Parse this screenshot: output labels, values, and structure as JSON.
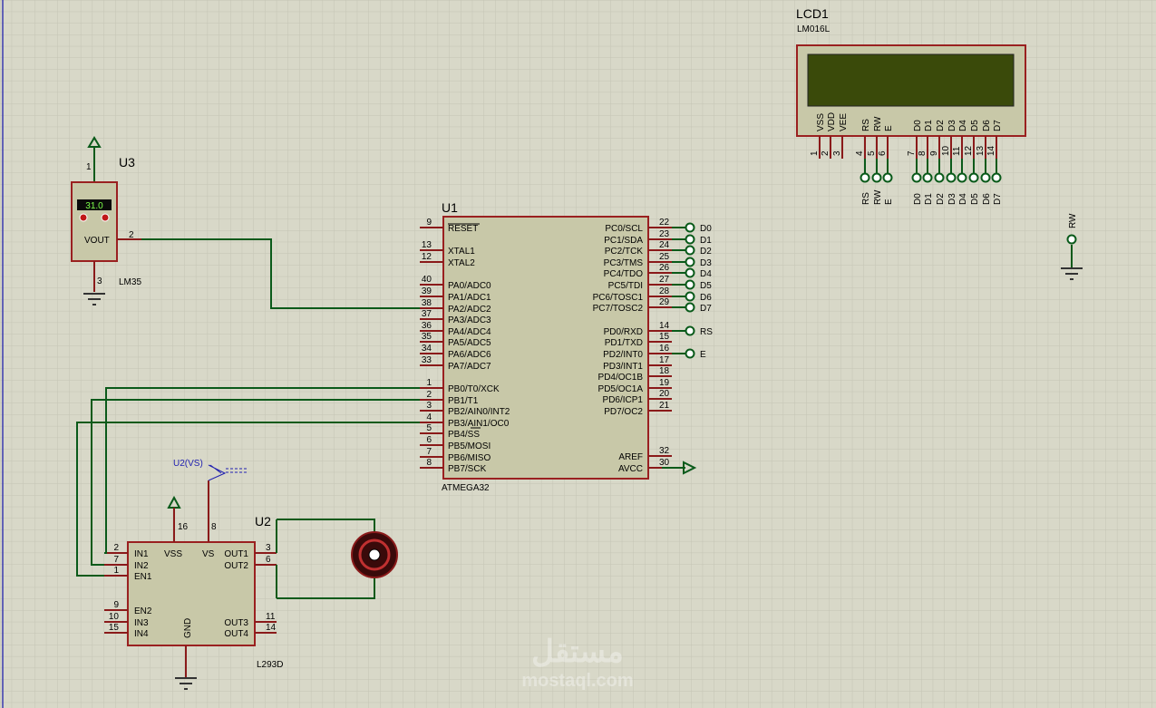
{
  "u1": {
    "ref": "U1",
    "part": "ATMEGA32",
    "left_pins": [
      {
        "num": "9",
        "name": "RESET"
      },
      {
        "num": "13",
        "name": "XTAL1"
      },
      {
        "num": "12",
        "name": "XTAL2"
      },
      {
        "num": "40",
        "name": "PA0/ADC0"
      },
      {
        "num": "39",
        "name": "PA1/ADC1"
      },
      {
        "num": "38",
        "name": "PA2/ADC2"
      },
      {
        "num": "37",
        "name": "PA3/ADC3"
      },
      {
        "num": "36",
        "name": "PA4/ADC4"
      },
      {
        "num": "35",
        "name": "PA5/ADC5"
      },
      {
        "num": "34",
        "name": "PA6/ADC6"
      },
      {
        "num": "33",
        "name": "PA7/ADC7"
      },
      {
        "num": "1",
        "name": "PB0/T0/XCK"
      },
      {
        "num": "2",
        "name": "PB1/T1"
      },
      {
        "num": "3",
        "name": "PB2/AIN0/INT2"
      },
      {
        "num": "4",
        "name": "PB3/AIN1/OC0"
      },
      {
        "num": "5",
        "name": "PB4/SS"
      },
      {
        "num": "6",
        "name": "PB5/MOSI"
      },
      {
        "num": "7",
        "name": "PB6/MISO"
      },
      {
        "num": "8",
        "name": "PB7/SCK"
      }
    ],
    "right_pins": [
      {
        "num": "22",
        "name": "PC0/SCL",
        "net": "D0"
      },
      {
        "num": "23",
        "name": "PC1/SDA",
        "net": "D1"
      },
      {
        "num": "24",
        "name": "PC2/TCK",
        "net": "D2"
      },
      {
        "num": "25",
        "name": "PC3/TMS",
        "net": "D3"
      },
      {
        "num": "26",
        "name": "PC4/TDO",
        "net": "D4"
      },
      {
        "num": "27",
        "name": "PC5/TDI",
        "net": "D5"
      },
      {
        "num": "28",
        "name": "PC6/TOSC1",
        "net": "D6"
      },
      {
        "num": "29",
        "name": "PC7/TOSC2",
        "net": "D7"
      },
      {
        "num": "14",
        "name": "PD0/RXD",
        "net": "RS"
      },
      {
        "num": "15",
        "name": "PD1/TXD",
        "net": ""
      },
      {
        "num": "16",
        "name": "PD2/INT0",
        "net": "E"
      },
      {
        "num": "17",
        "name": "PD3/INT1",
        "net": ""
      },
      {
        "num": "18",
        "name": "PD4/OC1B",
        "net": ""
      },
      {
        "num": "19",
        "name": "PD5/OC1A",
        "net": ""
      },
      {
        "num": "20",
        "name": "PD6/ICP1",
        "net": ""
      },
      {
        "num": "21",
        "name": "PD7/OC2",
        "net": ""
      },
      {
        "num": "32",
        "name": "AREF",
        "net": ""
      },
      {
        "num": "30",
        "name": "AVCC",
        "net": ""
      }
    ]
  },
  "lcd": {
    "ref": "LCD1",
    "part": "LM016L",
    "pins": [
      {
        "num": "1",
        "name": "VSS",
        "net": ""
      },
      {
        "num": "2",
        "name": "VDD",
        "net": ""
      },
      {
        "num": "3",
        "name": "VEE",
        "net": ""
      },
      {
        "num": "4",
        "name": "RS",
        "net": "RS"
      },
      {
        "num": "5",
        "name": "RW",
        "net": "RW"
      },
      {
        "num": "6",
        "name": "E",
        "net": "E"
      },
      {
        "num": "7",
        "name": "D0",
        "net": "D0"
      },
      {
        "num": "8",
        "name": "D1",
        "net": "D1"
      },
      {
        "num": "9",
        "name": "D2",
        "net": "D2"
      },
      {
        "num": "10",
        "name": "D3",
        "net": "D3"
      },
      {
        "num": "11",
        "name": "D4",
        "net": "D4"
      },
      {
        "num": "12",
        "name": "D5",
        "net": "D5"
      },
      {
        "num": "13",
        "name": "D6",
        "net": "D6"
      },
      {
        "num": "14",
        "name": "D7",
        "net": "D7"
      }
    ],
    "rw_label": "RW"
  },
  "u3": {
    "ref": "U3",
    "part": "LM35",
    "reading": "31.0",
    "pin_vout": "VOUT",
    "pin1": "1",
    "pin2": "2",
    "pin3": "3"
  },
  "u2": {
    "ref": "U2",
    "part": "L293D",
    "probe": "U2(VS)",
    "left_pins": [
      {
        "num": "2",
        "name": "IN1"
      },
      {
        "num": "7",
        "name": "IN2"
      },
      {
        "num": "1",
        "name": "EN1"
      },
      {
        "num": "9",
        "name": "EN2"
      },
      {
        "num": "10",
        "name": "IN3"
      },
      {
        "num": "15",
        "name": "IN4"
      }
    ],
    "right_pins": [
      {
        "num": "3",
        "name": "OUT1"
      },
      {
        "num": "6",
        "name": "OUT2"
      },
      {
        "num": "11",
        "name": "OUT3"
      },
      {
        "num": "14",
        "name": "OUT4"
      }
    ],
    "vss": {
      "num": "16",
      "name": "VSS"
    },
    "vs": {
      "num": "8",
      "name": "VS"
    },
    "gnd": "GND"
  },
  "watermark": {
    "arabic": "مستقل",
    "latin": "mostaql.com"
  },
  "colors": {
    "background": "#d8d8c8",
    "chip_fill": "#c8c8a8",
    "chip_border": "#9a2020",
    "wire": "#0a5a1a",
    "lcd_screen": "#3a4a0a",
    "grid": "#c4c4b4"
  }
}
